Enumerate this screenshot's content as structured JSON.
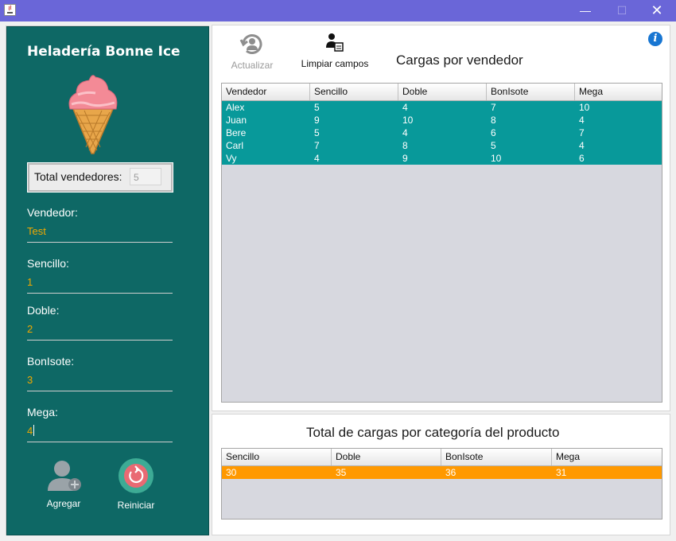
{
  "window": {
    "minimize": "—",
    "maximize": "☐",
    "close": "✕"
  },
  "left": {
    "brand": "Heladería Bonne Ice",
    "total_label": "Total vendedores:",
    "total_value": "5",
    "fields": [
      {
        "label": "Vendedor:",
        "value": "Test"
      },
      {
        "label": "Sencillo:",
        "value": "1"
      },
      {
        "label": "Doble:",
        "value": "2"
      },
      {
        "label": "BonIsote:",
        "value": "3"
      },
      {
        "label": "Mega:",
        "value": "4"
      }
    ],
    "add_label": "Agregar",
    "reset_label": "Reiniciar"
  },
  "toolbar": {
    "refresh_label": "Actualizar",
    "clear_label": "Limpiar campos"
  },
  "sales_table": {
    "title": "Cargas por vendedor",
    "columns": [
      "Vendedor",
      "Sencillo",
      "Doble",
      "BonIsote",
      "Mega"
    ],
    "rows": [
      [
        "Alex",
        "5",
        "4",
        "7",
        "10"
      ],
      [
        "Juan",
        "9",
        "10",
        "8",
        "4"
      ],
      [
        "Bere",
        "5",
        "4",
        "6",
        "7"
      ],
      [
        "Carl",
        "7",
        "8",
        "5",
        "4"
      ],
      [
        "Vy",
        "4",
        "9",
        "10",
        "6"
      ]
    ],
    "row_color": "#08999a"
  },
  "totals_table": {
    "title": "Total de cargas por categoría del producto",
    "columns": [
      "Sencillo",
      "Doble",
      "BonIsote",
      "Mega"
    ],
    "rows": [
      [
        "30",
        "35",
        "36",
        "31"
      ]
    ],
    "row_color": "#ff9900"
  }
}
